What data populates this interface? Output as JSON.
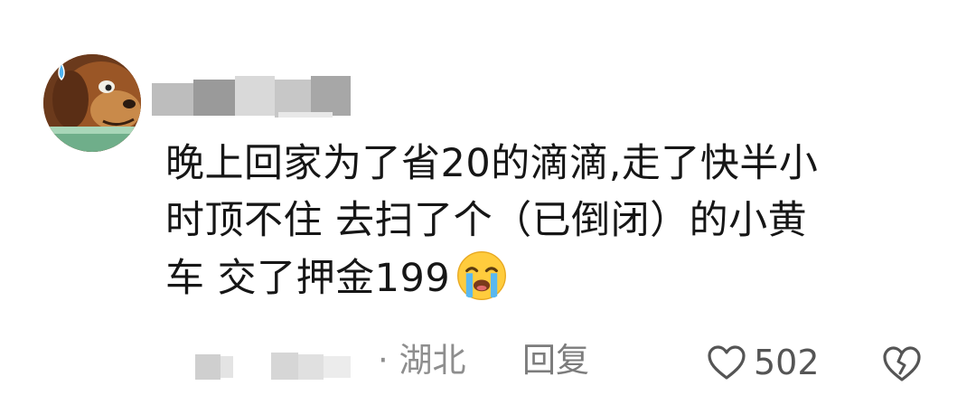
{
  "comment": {
    "avatar_icon": "cartoon-dog-with-sweat-drop",
    "username_redacted": true,
    "text_line1": "晚上回家为了省20的滴滴,走了快半小",
    "text_line2": "时顶不住 去扫了个（已倒闭）的小黄",
    "text_line3": "车 交了押金199",
    "emoji": "loudly-crying-face",
    "timestamp_redacted": true,
    "location": "· 湖北",
    "reply_label": "回复",
    "like_count": "502",
    "like_icon": "heart-outline-icon",
    "dislike_icon": "broken-heart-icon"
  },
  "colors": {
    "text": "#161616",
    "meta": "#8e8e8e",
    "icon": "#555555"
  }
}
